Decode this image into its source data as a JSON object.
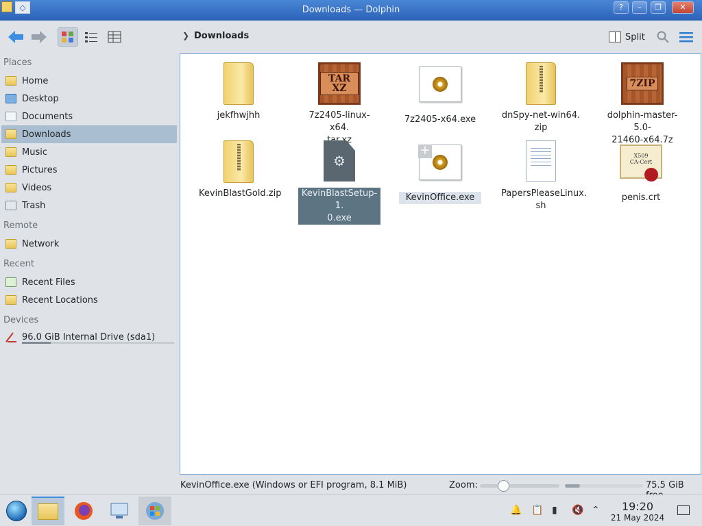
{
  "window": {
    "title": "Downloads — Dolphin"
  },
  "toolbar": {
    "breadcrumb": "Downloads",
    "split_label": "Split"
  },
  "sidebar": {
    "sections": {
      "places": "Places",
      "remote": "Remote",
      "recent": "Recent",
      "devices": "Devices"
    },
    "places": [
      "Home",
      "Desktop",
      "Documents",
      "Downloads",
      "Music",
      "Pictures",
      "Videos",
      "Trash"
    ],
    "remote": [
      "Network"
    ],
    "recent": [
      "Recent Files",
      "Recent Locations"
    ],
    "devices": [
      "96.0 GiB Internal Drive (sda1)"
    ],
    "drive_usage": 0.19
  },
  "files": [
    {
      "name": "jekfhwjhh",
      "icon": "folder-icon"
    },
    {
      "name": "7z2405-linux-x64.\ntar.xz",
      "icon": "tar-xz-archive-icon",
      "label": "TAR XZ"
    },
    {
      "name": "7z2405-x64.exe",
      "icon": "exe-icon"
    },
    {
      "name": "dnSpy-net-win64.\nzip",
      "icon": "zip-folder-icon"
    },
    {
      "name": "dolphin-master-5.0-\n21460-x64.7z",
      "icon": "7zip-archive-icon",
      "label": "7ZIP"
    },
    {
      "name": "KevinBlastGold.zip",
      "icon": "zip-folder-icon"
    },
    {
      "name": "KevinBlastSetup-1.\n0.exe",
      "icon": "executable-icon"
    },
    {
      "name": "KevinOffice.exe",
      "icon": "exe-icon"
    },
    {
      "name": "PapersPleaseLinux.\nsh",
      "icon": "script-icon"
    },
    {
      "name": "penis.crt",
      "icon": "certificate-icon",
      "label": "X509\nCA-Cert"
    }
  ],
  "status": {
    "info": "KevinOffice.exe (Windows or EFI program, 8.1 MiB)",
    "zoom_label": "Zoom:",
    "zoom_level": 0.22,
    "free_space": "75.5 GiB free",
    "used_fraction": 0.19
  },
  "taskbar": {
    "time": "19:20",
    "date": "21 May 2024"
  },
  "colors": {
    "selection": "#a9bfd1",
    "selected_file": "#5d7483",
    "accent": "#3d8ee0"
  }
}
